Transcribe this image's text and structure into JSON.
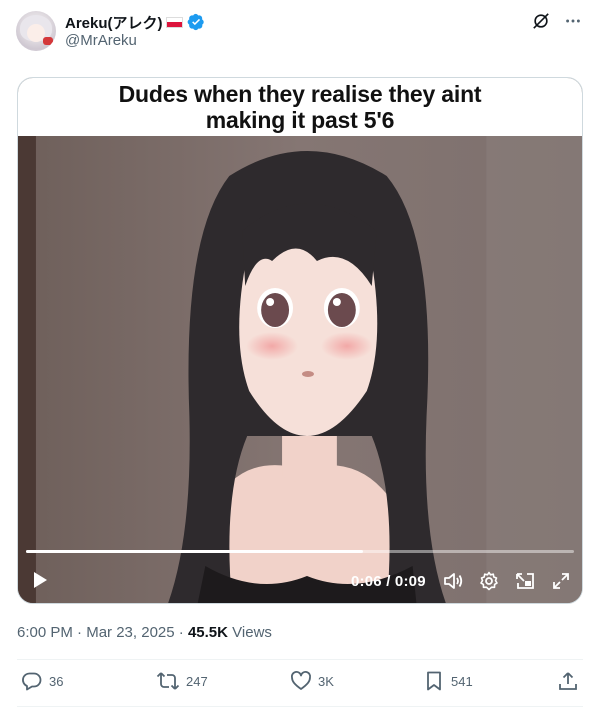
{
  "author": {
    "display_name": "Areku(アレク)",
    "handle": "@MrAreku",
    "verified": true,
    "flag_icon": "poland-flag-icon"
  },
  "top_icons": [
    "grok-icon",
    "more-icon"
  ],
  "media": {
    "caption": "Dudes when they realise they aint making it past 5'6",
    "progress": 0.615,
    "time_display": "0:06 / 0:09",
    "controls": [
      "play-icon",
      "volume-icon",
      "settings-icon",
      "pip-icon",
      "fullscreen-icon"
    ]
  },
  "meta": {
    "time": "6:00 PM",
    "separator": "·",
    "date": "Mar 23, 2025",
    "views_count": "45.5K",
    "views_label": "Views"
  },
  "actions": {
    "replies": "36",
    "reposts": "247",
    "likes": "3K",
    "bookmarks": "541"
  },
  "colors": {
    "verified_blue": "#1d9bf0",
    "text_secondary": "#536471",
    "text_primary": "#0f1419"
  }
}
